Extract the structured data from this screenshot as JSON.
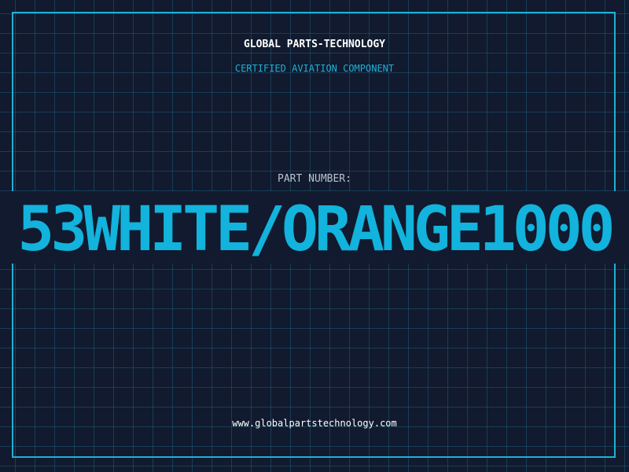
{
  "header": {
    "company_name": "GLOBAL PARTS-TECHNOLOGY",
    "subtitle": "CERTIFIED AVIATION COMPONENT"
  },
  "part": {
    "label": "PART NUMBER:",
    "number": "53WHITE/ORANGE1000"
  },
  "footer": {
    "website": "www.globalpartstechnology.com"
  },
  "colors": {
    "background": "#111a2e",
    "grid": "#1e5a78",
    "accent": "#12b3dc",
    "heading": "#ffffff",
    "label": "#b9c3cf"
  }
}
